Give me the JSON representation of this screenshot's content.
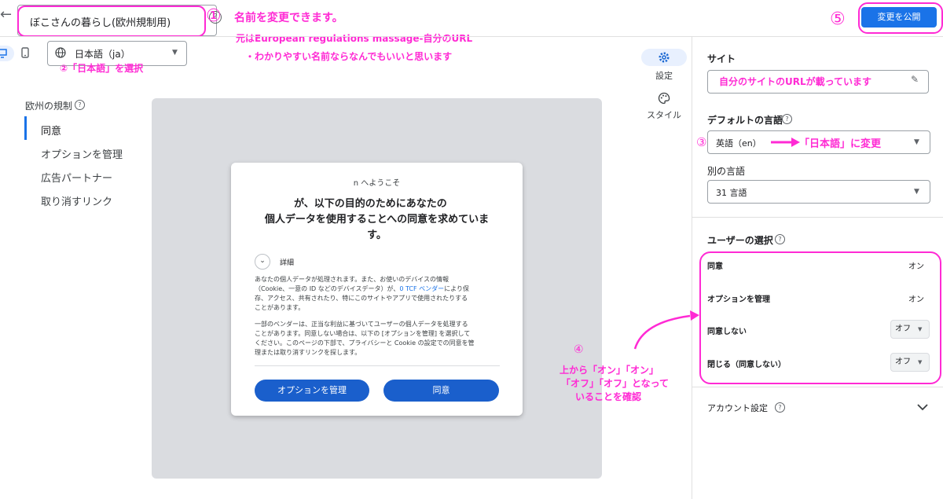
{
  "header": {
    "back_icon": "←",
    "site_name": "ぼこさんの暮らし(欧州規制用)",
    "help_icon": "?",
    "publish_label": "変更を公開"
  },
  "device_bar": {
    "language_value": "日本語（ja）"
  },
  "annotations": {
    "a1_num": "①",
    "a1_text": "名前を変更できます。",
    "a1_sub1": "元はEuropean regulations massage-自分のURL",
    "a1_sub2": "・わかりやすい名前ならなんでもいいと思います",
    "a2_text": "②「日本語」を選択",
    "a3_num": "③",
    "a3_text": "「日本語」に変更",
    "a4_num": "④",
    "a4_line1": "上から「オン」「オン」",
    "a4_line2": "「オフ」「オフ」となって",
    "a4_line3": "いることを確認",
    "a5_num": "⑤"
  },
  "left_nav": {
    "title": "欧州の規制",
    "items": [
      "同意",
      "オプションを管理",
      "広告パートナー",
      "取り消すリンク"
    ]
  },
  "dialog": {
    "welcome": "n へようこそ",
    "heading_line1": "が、以下の目的のためにあなたの",
    "heading_line2": "個人データを使用することへの同意を求めていま",
    "heading_line3": "す。",
    "details_label": "詳細",
    "body1_line1": "あなたの個人データが処理されます。また、お使いのデバイスの情報",
    "body1_line2a": "（Cookie、一意の ID などのデバイスデータ）が、",
    "body1_link": "0 TCF ベンダー",
    "body1_line2b": "により保",
    "body1_line3": "存、アクセス、共有されたり、特にこのサイトやアプリで使用されたりする",
    "body1_line4": "ことがあります。",
    "body2_line1": "一部のベンダーは、正当な利益に基づいてユーザーの個人データを処理する",
    "body2_line2": "ことがあります。同意しない場合は、以下の [オプションを管理] を選択して",
    "body2_line3": "ください。このページの下部で、プライバシーと Cookie の設定での同意を管",
    "body2_line4": "理または取り消すリンクを探します。",
    "manage_button": "オプションを管理",
    "consent_button": "同意"
  },
  "rail": {
    "settings_label": "設定",
    "style_label": "スタイル"
  },
  "panel": {
    "site_title": "サイト",
    "site_value": "自分のサイトのURLが載っています",
    "default_lang_title": "デフォルトの言語",
    "default_lang_value": "英語（en）",
    "other_lang_title": "別の言語",
    "other_lang_value": "31 言語",
    "user_choice_title": "ユーザーの選択",
    "choices": [
      {
        "label": "同意",
        "value": "オン"
      },
      {
        "label": "オプションを管理",
        "value": "オン"
      },
      {
        "label": "同意しない",
        "value": "オフ"
      },
      {
        "label": "閉じる（同意しない）",
        "value": "オフ"
      }
    ],
    "account_title": "アカウント設定"
  }
}
